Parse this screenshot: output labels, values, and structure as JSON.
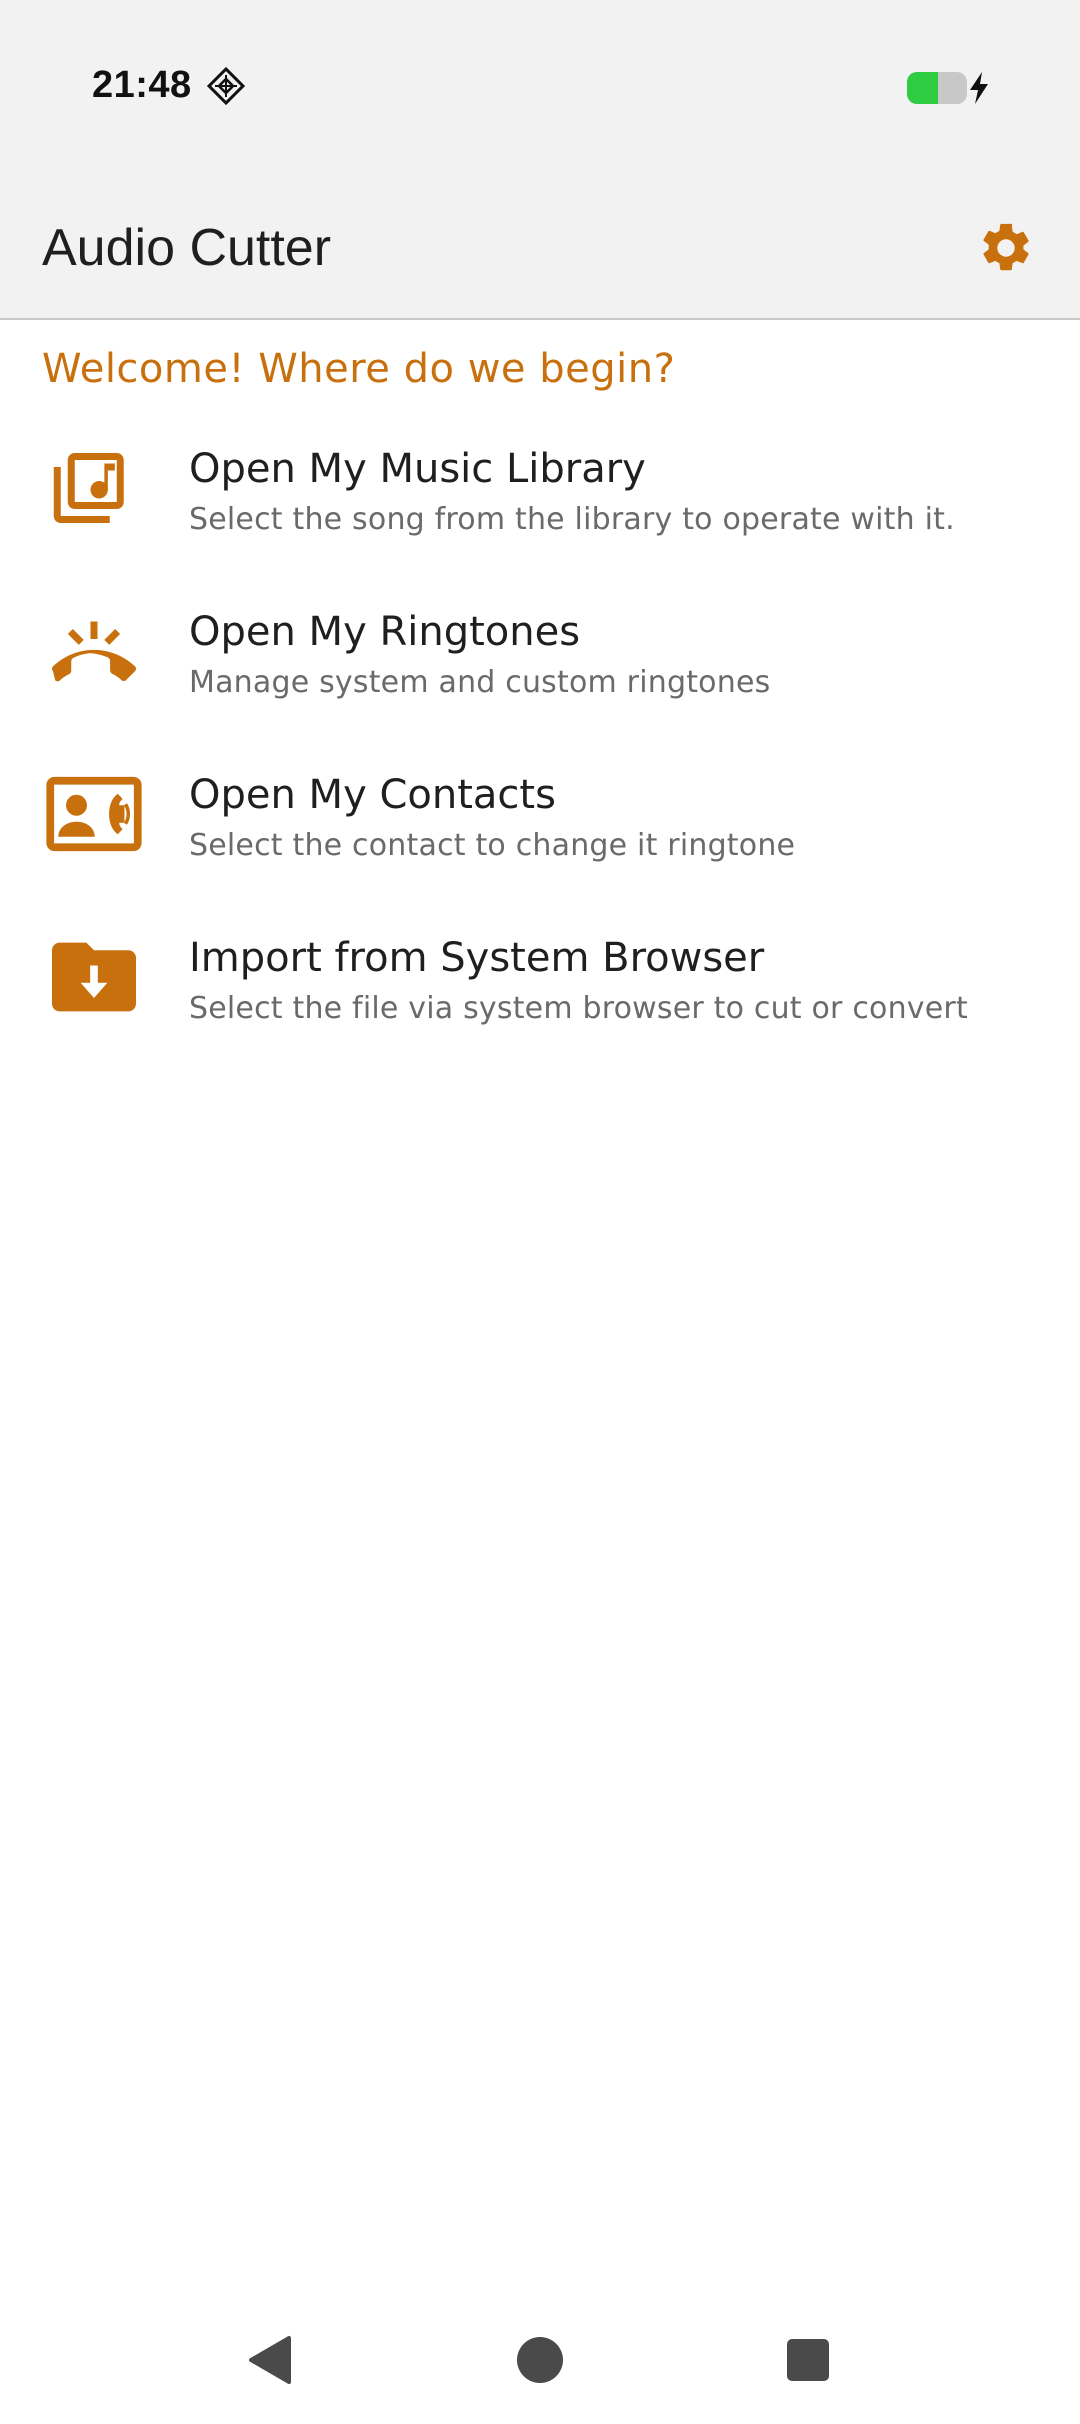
{
  "status_bar": {
    "time": "21:48",
    "notification_icon": "diamond-grid-icon",
    "battery_icon": "battery-charging-icon"
  },
  "app_bar": {
    "title": "Audio Cutter",
    "settings_icon": "gear-icon"
  },
  "welcome_text": "Welcome! Where do we begin?",
  "menu": {
    "items": [
      {
        "title": "Open My Music Library",
        "subtitle": "Select the song from the library to operate with it.",
        "icon": "music-library-icon"
      },
      {
        "title": "Open My Ringtones",
        "subtitle": "Manage system and custom ringtones",
        "icon": "ringing-phone-icon"
      },
      {
        "title": "Open My Contacts",
        "subtitle": "Select the contact to change it ringtone",
        "icon": "contact-card-icon"
      },
      {
        "title": "Import from System Browser",
        "subtitle": "Select the file via system browser to cut or convert",
        "icon": "folder-download-icon"
      }
    ]
  },
  "nav_bar": {
    "back_icon": "back-triangle-icon",
    "home_icon": "home-circle-icon",
    "recents_icon": "recents-square-icon"
  },
  "colors": {
    "accent": "#c8700d",
    "app_bar_bg": "#f2f2f2",
    "battery_green": "#2ecc40"
  }
}
